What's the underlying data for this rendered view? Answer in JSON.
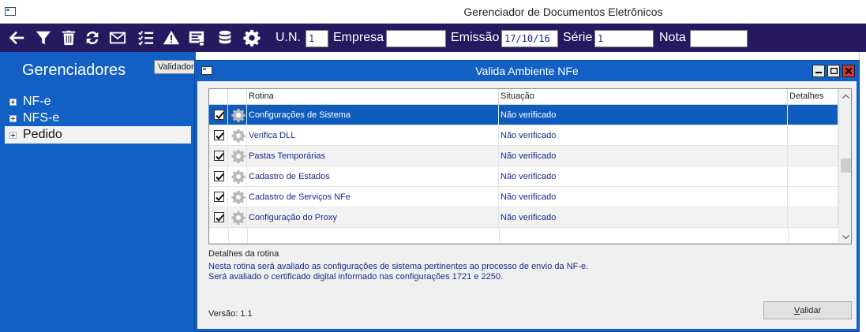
{
  "window": {
    "title": "Gerenciador de Documentos Eletrônicos"
  },
  "toolbar": {
    "icons": [
      "back-arrow-icon",
      "filter-icon",
      "trash-icon",
      "refresh-icon",
      "envelope-icon",
      "checklist-icon",
      "warning-icon",
      "document-icon",
      "database-icon",
      "gear-icon"
    ],
    "fields": {
      "un_label": "U.N.",
      "un_value": "1",
      "empresa_label": "Empresa",
      "empresa_value": "",
      "emissao_label": "Emissão",
      "emissao_value": "17/10/16",
      "serie_label": "Série",
      "serie_value": "1",
      "nota_label": "Nota",
      "nota_value": ""
    }
  },
  "sidebar": {
    "heading": "Gerenciadores",
    "tooltip": "Validador",
    "items": [
      {
        "label": "NF-e"
      },
      {
        "label": "NFS-e"
      },
      {
        "label": "Pedido"
      }
    ]
  },
  "dialog": {
    "title": "Valida Ambiente NFe",
    "columns": {
      "rotina": "Rotina",
      "situacao": "Situação",
      "detalhes": "Detalhes"
    },
    "rows": [
      {
        "rotina": "Configurações de Sistema",
        "situacao": "Não verificado",
        "checked": true
      },
      {
        "rotina": "Verifica DLL",
        "situacao": "Não verificado",
        "checked": true
      },
      {
        "rotina": "Pastas Temporárias",
        "situacao": "Não verificado",
        "checked": true
      },
      {
        "rotina": "Cadastro de Estados",
        "situacao": "Não verificado",
        "checked": true
      },
      {
        "rotina": "Cadastro de Serviços NFe",
        "situacao": "Não verificado",
        "checked": true
      },
      {
        "rotina": "Configuração do Proxy",
        "situacao": "Não verificado",
        "checked": true
      }
    ],
    "details_label": "Detalhes da rotina",
    "details_line1": "Nesta rotina será avaliado as configurações de sistema pertinentes ao processo de envio da NF-e.",
    "details_line2": "Será avaliado o certificado digital informado nas configurações 1721 e 2250.",
    "version": "Versão: 1.1",
    "validate_button_accel": "V",
    "validate_button_rest": "alidar"
  },
  "colors": {
    "toolbar_bg": "#27195f",
    "sidebar_bg": "#1260c4",
    "selected_row": "#0f5cbf",
    "text_blue": "#1a2a8a"
  }
}
